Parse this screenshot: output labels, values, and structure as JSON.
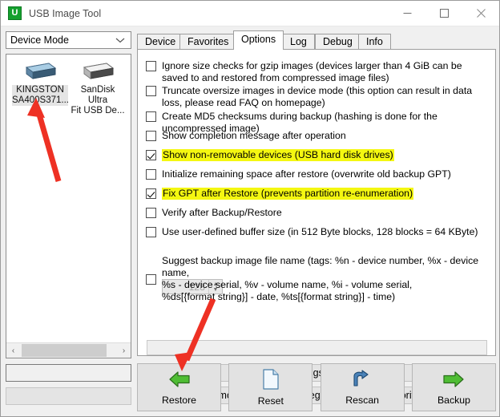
{
  "window": {
    "title": "USB Image Tool",
    "app_icon": "usb-image-tool-icon",
    "icon_letter": "U",
    "minimize_label": "Minimize",
    "maximize_label": "Maximize",
    "close_label": "Close"
  },
  "sidebar": {
    "mode_select": {
      "value": "Device Mode",
      "chevron": "chevron-down-icon"
    },
    "devices": [
      {
        "name": "KINGSTON\nSA400S371...",
        "icon": "hard-drive-icon",
        "selected": true
      },
      {
        "name": "SanDisk Ultra\nFit USB De...",
        "icon": "usb-drive-icon",
        "selected": false
      }
    ],
    "scroll": {
      "left_arrow": "‹",
      "right_arrow": "›"
    },
    "field_white": "",
    "field_gray": ""
  },
  "tabs": [
    {
      "label": "Device",
      "active": false
    },
    {
      "label": "Favorites",
      "active": false
    },
    {
      "label": "Options",
      "active": true
    },
    {
      "label": "Log",
      "active": false
    },
    {
      "label": "Debug",
      "active": false
    },
    {
      "label": "Info",
      "active": false
    }
  ],
  "options": [
    {
      "label": "Ignore size checks for gzip images (devices larger than 4 GiB can be saved to and restored from compressed image files)",
      "checked": false,
      "highlighted": false
    },
    {
      "label": "Truncate oversize images in device mode (this option can result in data loss, please read FAQ on homepage)",
      "checked": false,
      "highlighted": false
    },
    {
      "label": "Create MD5 checksums during backup (hashing is done for the uncompressed image)",
      "checked": false,
      "highlighted": false
    },
    {
      "label": "Show completion message after operation",
      "checked": false,
      "highlighted": false
    },
    {
      "label": "Show non-removable devices (USB hard disk drives)",
      "checked": true,
      "highlighted": true
    },
    {
      "label": "Initialize remaining space after restore (overwrite old backup GPT)",
      "checked": false,
      "highlighted": false
    },
    {
      "label": "Fix GPT after Restore (prevents partition re-enumeration)",
      "checked": true,
      "highlighted": true
    },
    {
      "label": "Verify after Backup/Restore",
      "checked": false,
      "highlighted": false
    },
    {
      "label": "Use user-defined buffer size (in 512 Byte blocks, 128 blocks = 64 KByte)",
      "checked": false,
      "highlighted": false
    },
    {
      "label": "Suggest backup image file name (tags: %n - device number, %x - device name,\n%s - device serial, %v - volume name, %i - volume serial,\n%ds[{format string}] - date, %ts[{format string}] - time)",
      "checked": false,
      "highlighted": false
    }
  ],
  "buffer_spinner": {
    "value": "128",
    "up": "▲",
    "down": "▼"
  },
  "filename_input": {
    "value": "",
    "placeholder": ""
  },
  "registry_buttons": [
    {
      "label": "Save settings to registry"
    },
    {
      "label": "Remove settings from registry (including favorites)"
    }
  ],
  "actions": [
    {
      "label": "Restore",
      "icon": "green-left-arrow-icon"
    },
    {
      "label": "Reset",
      "icon": "document-page-icon"
    },
    {
      "label": "Rescan",
      "icon": "blue-refresh-arrow-icon"
    },
    {
      "label": "Backup",
      "icon": "green-right-arrow-icon"
    }
  ],
  "annotations": {
    "arrow_color": "#ee3124",
    "arrows": [
      {
        "name": "arrow-to-kingston-device",
        "points_to": "KINGSTON device item"
      },
      {
        "name": "arrow-to-restore-button",
        "points_to": "Restore button"
      }
    ]
  },
  "colors": {
    "highlight": "#f4f711",
    "accent_green": "#14a02e",
    "selection": "#e4e4e4"
  }
}
